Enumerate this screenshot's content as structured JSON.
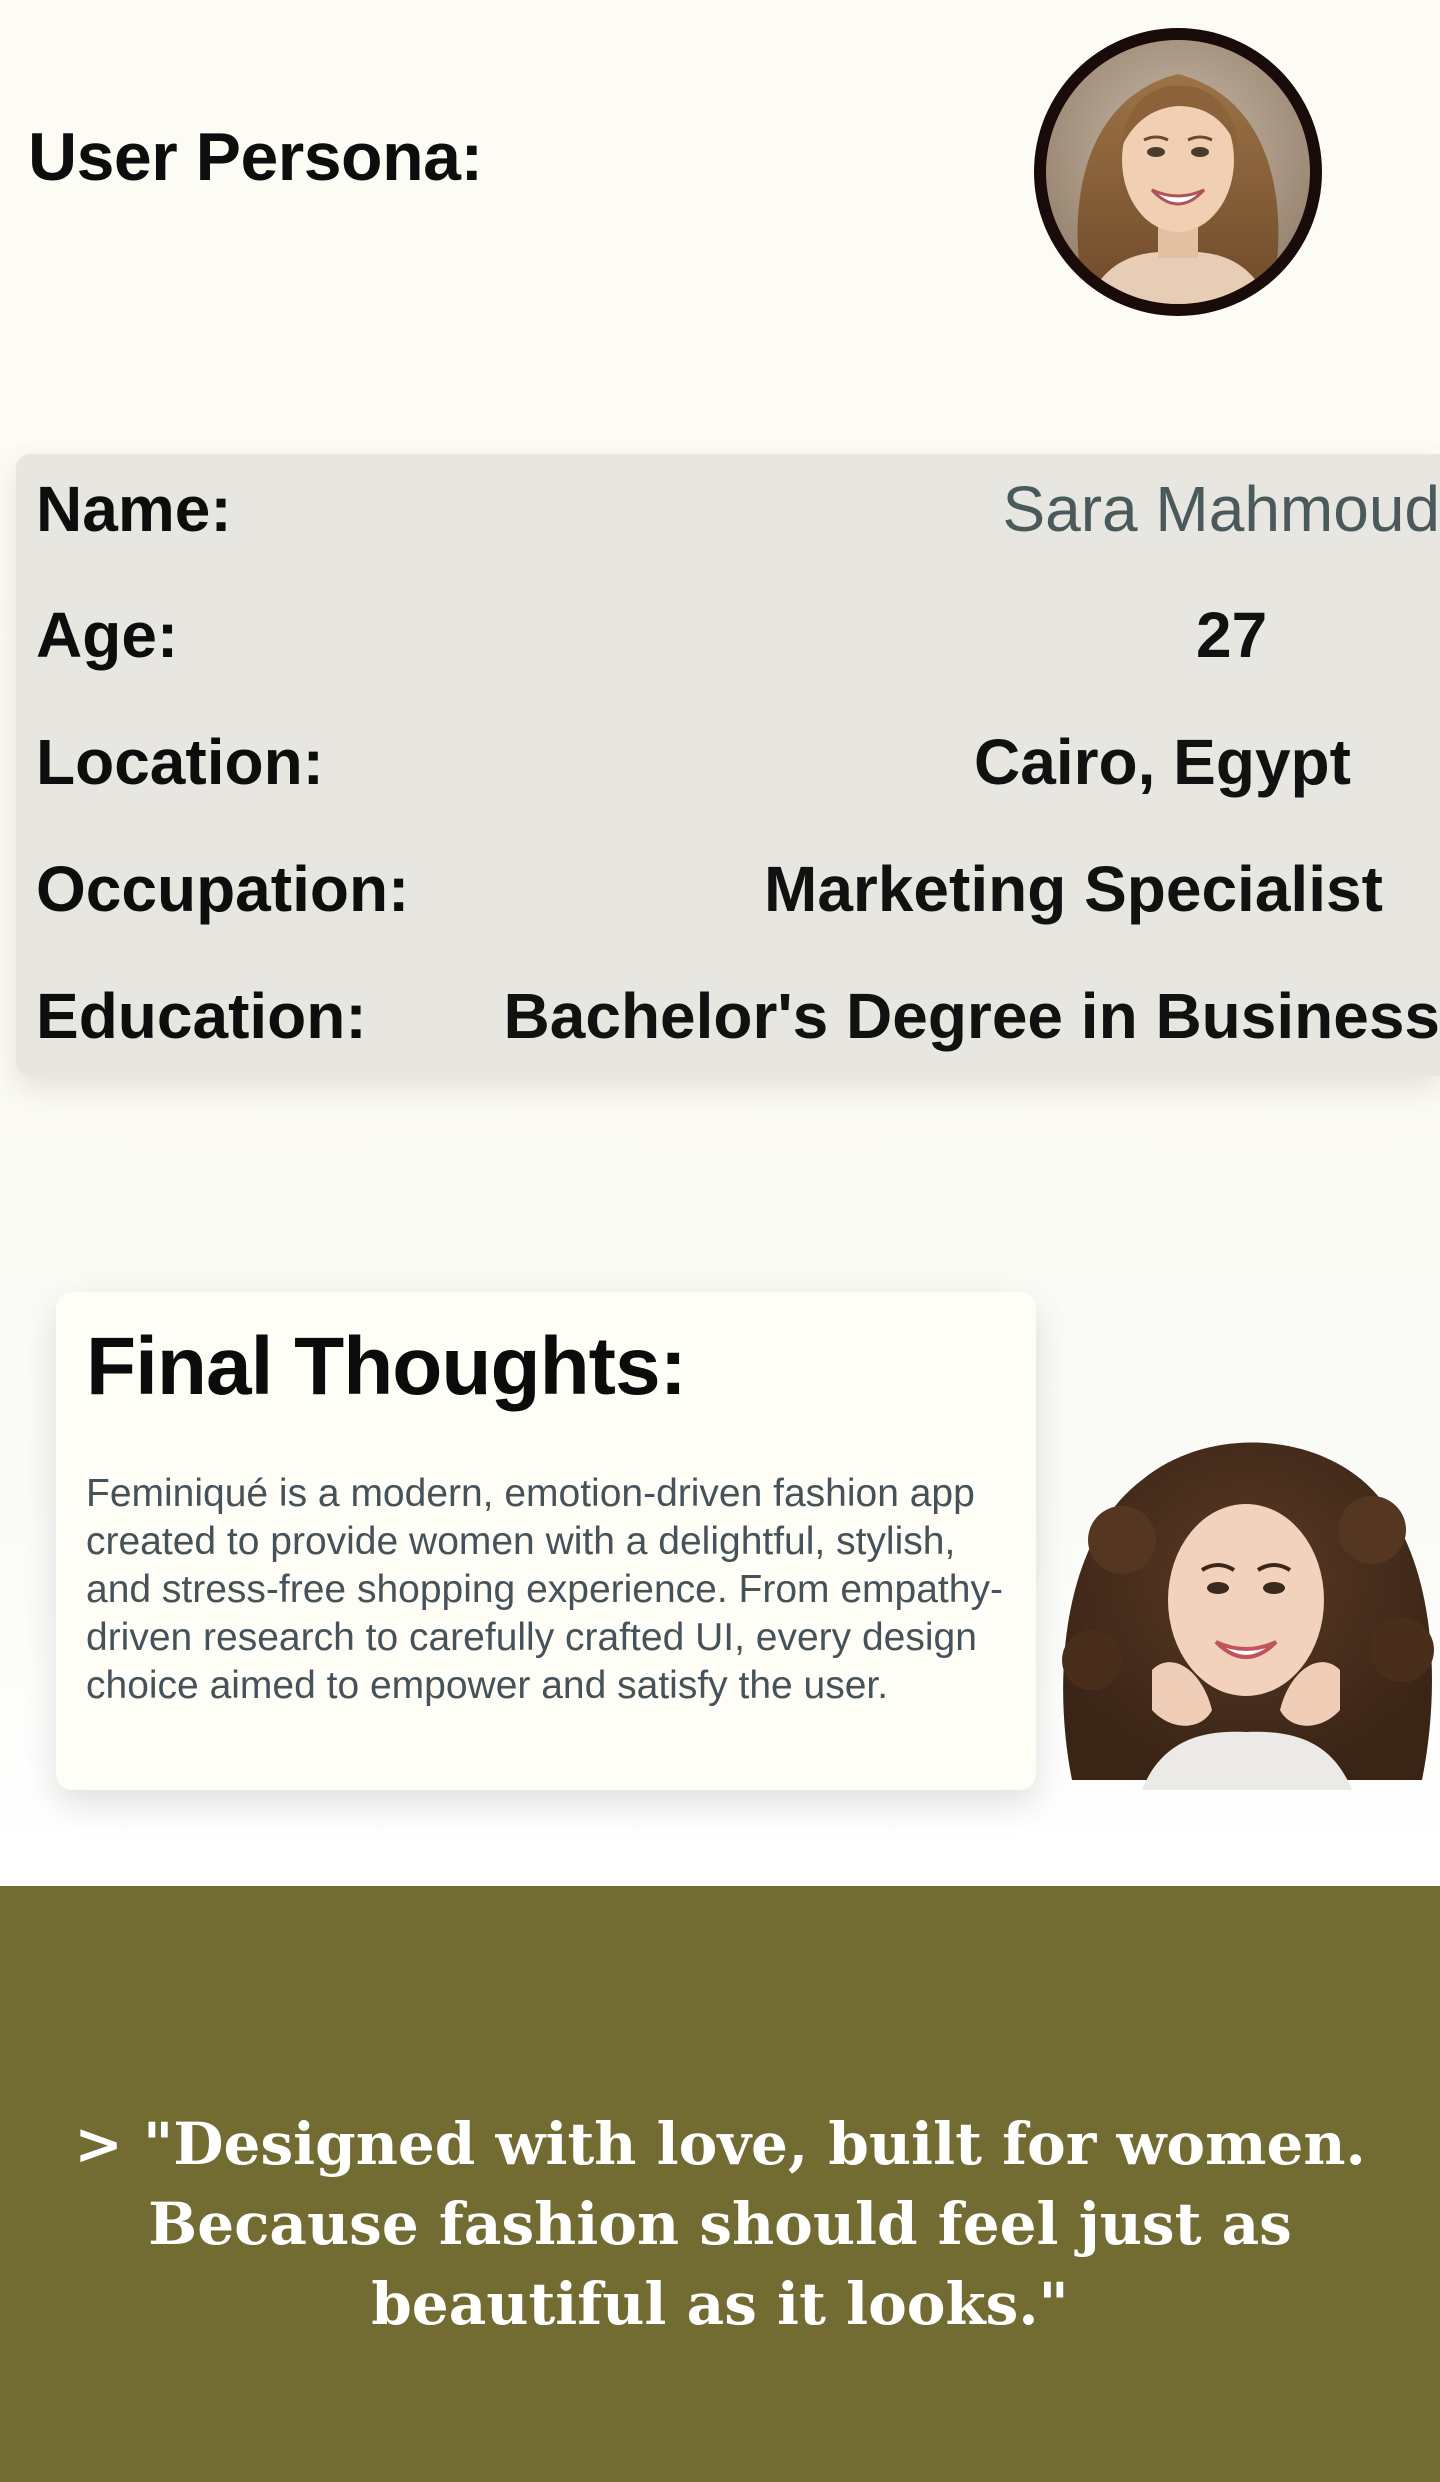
{
  "persona": {
    "heading": "User Persona:"
  },
  "profile": {
    "rows": [
      {
        "label": "Name:",
        "value": "Sara Mahmoud"
      },
      {
        "label": "Age:",
        "value": "27"
      },
      {
        "label": "Location:",
        "value": "Cairo, Egypt"
      },
      {
        "label": "Occupation:",
        "value": "Marketing Specialist"
      },
      {
        "label": "Education:",
        "value": "Bachelor's Degree in Business"
      }
    ]
  },
  "final_thoughts": {
    "title": "Final Thoughts:",
    "body": "Feminiqué is a modern, emotion-driven fashion app created to provide women with a delightful, stylish, and stress-free shopping experience. From empathy-driven research to carefully crafted UI, every design choice aimed to empower and satisfy the user."
  },
  "quote": {
    "text": "> \"Designed with love, built for women. Because fashion should feel just as beautiful as it looks.\""
  },
  "colors": {
    "banner": "#726c32",
    "card": "#e7e6e1",
    "name_value": "#4a5a5b",
    "body_text": "#46525a"
  }
}
